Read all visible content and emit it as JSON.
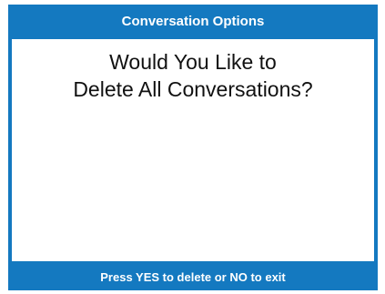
{
  "dialog": {
    "title": "Conversation Options",
    "question_line1": "Would You Like to",
    "question_line2": "Delete All Conversations?",
    "footer": "Press YES to delete or NO to exit"
  },
  "colors": {
    "frame": "#1479c0",
    "content_bg": "#ffffff",
    "title_text": "#ffffff",
    "body_text": "#111111"
  }
}
